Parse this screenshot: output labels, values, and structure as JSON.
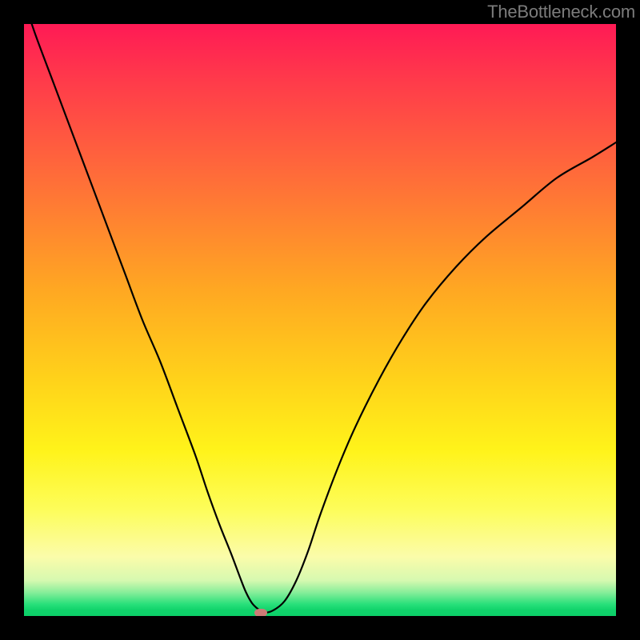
{
  "watermark": "TheBottleneck.com",
  "chart_data": {
    "type": "line",
    "title": "",
    "xlabel": "",
    "ylabel": "",
    "xlim": [
      0,
      100
    ],
    "ylim": [
      0,
      100
    ],
    "gradient_colors": {
      "top": "#ff1a55",
      "upper_mid": "#ffa822",
      "lower_mid": "#fff31a",
      "bottom": "#0ccf68"
    },
    "series": [
      {
        "name": "bottleneck-curve",
        "x": [
          0,
          2,
          5,
          8,
          11,
          14,
          17,
          20,
          23,
          26,
          29,
          31,
          33,
          35,
          36.5,
          37.5,
          38.5,
          39.5,
          40.5,
          42,
          44,
          46,
          48,
          50,
          53,
          56,
          60,
          64,
          68,
          73,
          78,
          84,
          90,
          96,
          100
        ],
        "y": [
          104,
          98,
          90,
          82,
          74,
          66,
          58,
          50,
          43,
          35,
          27,
          21,
          15.5,
          10.5,
          6.5,
          4,
          2.2,
          1.2,
          0.6,
          0.9,
          2.5,
          6,
          11,
          17,
          25,
          32,
          40,
          47,
          53,
          59,
          64,
          69,
          74,
          77.5,
          80
        ]
      }
    ],
    "marker": {
      "x": 40,
      "y": 0.5,
      "color": "#cc7b76"
    }
  }
}
